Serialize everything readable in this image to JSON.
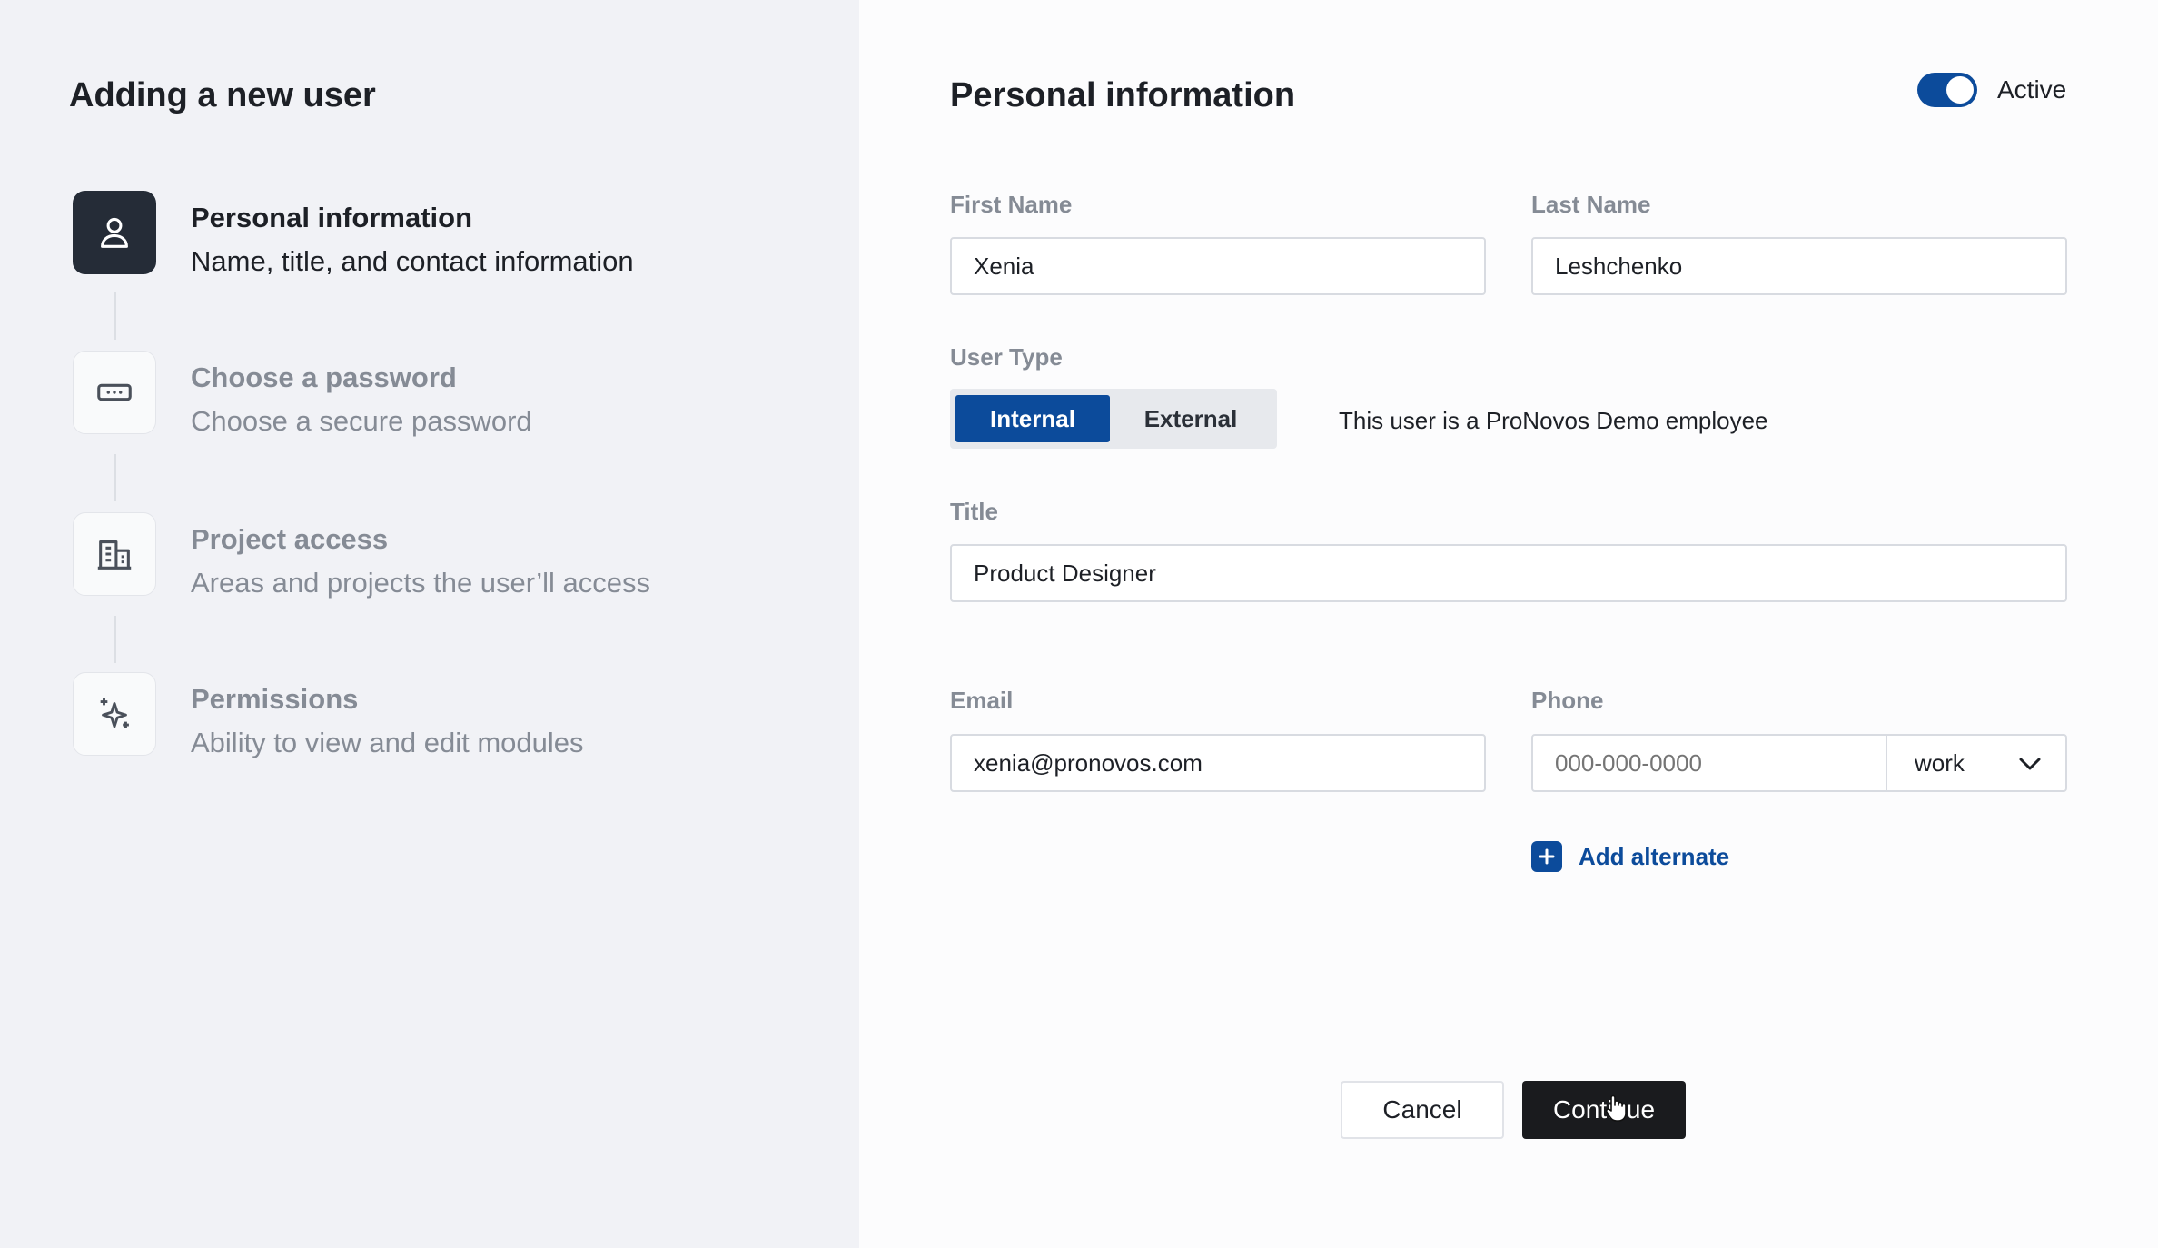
{
  "left_panel": {
    "title": "Adding a new user",
    "steps": [
      {
        "title": "Personal information",
        "subtitle": "Name, title, and contact information",
        "icon": "user-icon",
        "active": true
      },
      {
        "title": "Choose a password",
        "subtitle": "Choose a secure password",
        "icon": "password-icon",
        "active": false
      },
      {
        "title": "Project access",
        "subtitle": "Areas and projects the user’ll access",
        "icon": "building-icon",
        "active": false
      },
      {
        "title": "Permissions",
        "subtitle": "Ability to view and edit modules",
        "icon": "sparkle-icon",
        "active": false
      }
    ]
  },
  "form": {
    "title": "Personal information",
    "active_toggle": {
      "label": "Active",
      "on": true
    },
    "first_name": {
      "label": "First Name",
      "value": "Xenia"
    },
    "last_name": {
      "label": "Last Name",
      "value": "Leshchenko"
    },
    "user_type": {
      "label": "User Type",
      "options": [
        "Internal",
        "External"
      ],
      "selected": "Internal",
      "note": "This user is a ProNovos Demo employee"
    },
    "title_field": {
      "label": "Title",
      "value": "Product Designer"
    },
    "email": {
      "label": "Email",
      "value": "xenia@pronovos.com"
    },
    "phone": {
      "label": "Phone",
      "placeholder": "000-000-0000",
      "type": "work"
    },
    "add_alternate": "Add alternate",
    "cancel": "Cancel",
    "continue": "Continue"
  },
  "colors": {
    "accent": "#0c4b9b",
    "left_bg": "#f1f2f6",
    "active_step_bg": "#252c37",
    "continue_bg": "#1a1b1e"
  }
}
